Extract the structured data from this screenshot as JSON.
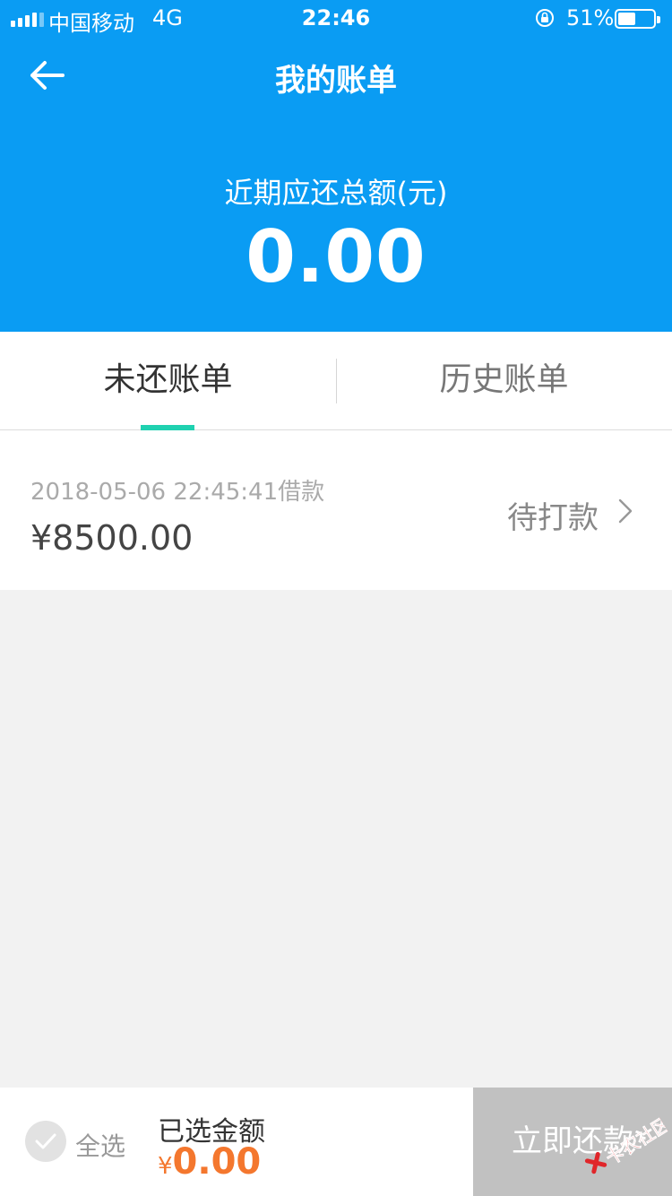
{
  "status_bar": {
    "carrier": "中国移动",
    "network": "4G",
    "time": "22:46",
    "battery_percent": "51%",
    "battery_level": 0.51,
    "icons": [
      "signal-icon",
      "rotation-lock-icon",
      "battery-icon"
    ]
  },
  "nav": {
    "title": "我的账单",
    "back_icon": "back-arrow-icon"
  },
  "summary": {
    "label": "近期应还总额(元)",
    "amount": "0.00"
  },
  "tabs": [
    {
      "label": "未还账单",
      "active": true
    },
    {
      "label": "历史账单",
      "active": false
    }
  ],
  "bills": [
    {
      "date_text": "2018-05-06 22:45:41借款",
      "amount": "¥8500.00",
      "status": "待打款",
      "chevron_icon": "chevron-right-icon"
    }
  ],
  "footer": {
    "select_all_label": "全选",
    "selected_label": "已选金额",
    "currency_symbol": "¥",
    "selected_amount": "0.00",
    "repay_button": "立即还款"
  },
  "colors": {
    "header_bg": "#0a9cf3",
    "tab_indicator": "#1fd1b0",
    "amount_orange": "#f4772e",
    "repay_button_bg": "#c1c1c1",
    "page_bg": "#f2f2f2"
  },
  "watermark": {
    "text": "卡农社区",
    "icon": "watermark-logo-icon"
  }
}
